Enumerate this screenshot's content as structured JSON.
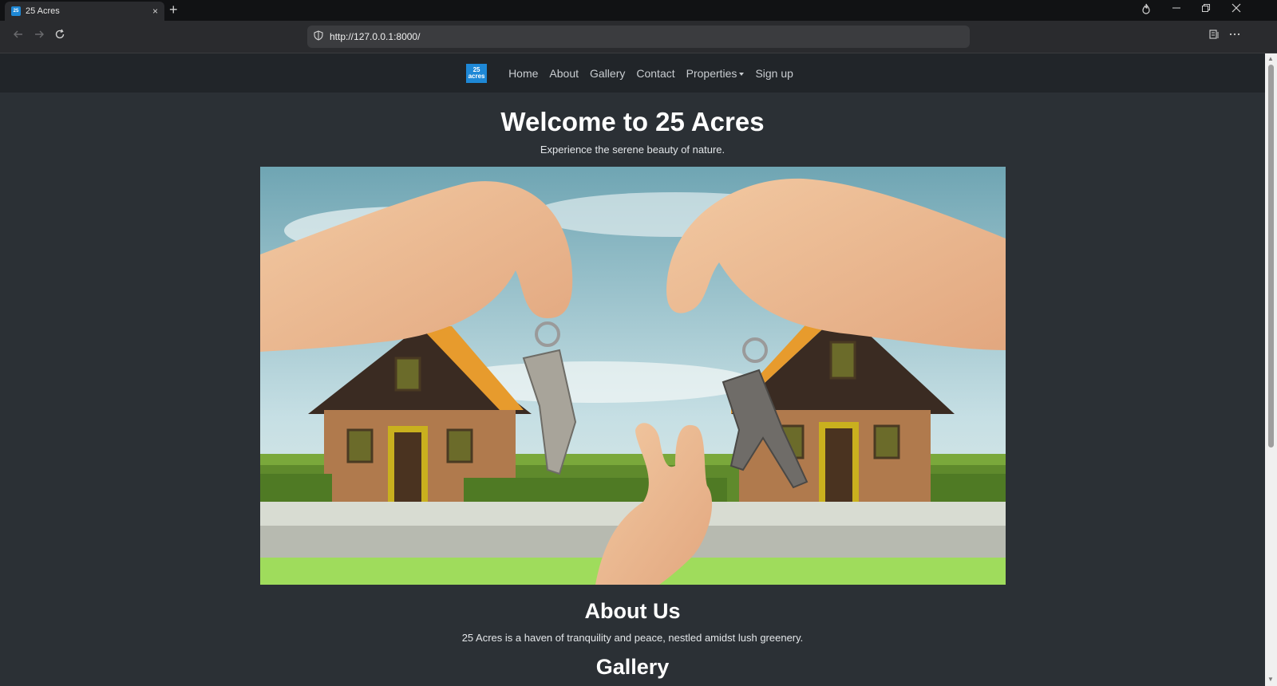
{
  "browser": {
    "tab_title": "25 Acres",
    "tab_close": "×",
    "new_tab": "+",
    "url": "http://127.0.0.1:8000/"
  },
  "nav": {
    "logo_line1": "25",
    "logo_line2": "acres",
    "links": [
      "Home",
      "About",
      "Gallery",
      "Contact",
      "Properties",
      "Sign up"
    ]
  },
  "hero": {
    "title": "Welcome to 25 Acres",
    "subtitle": "Experience the serene beauty of nature."
  },
  "about": {
    "title": "About Us",
    "text": "25 Acres is a haven of tranquility and peace, nestled amidst lush greenery."
  },
  "gallery": {
    "title": "Gallery"
  },
  "colors": {
    "page_bg": "#2b3035",
    "navbar_bg": "#212529",
    "brand_blue": "#1e88d6"
  }
}
